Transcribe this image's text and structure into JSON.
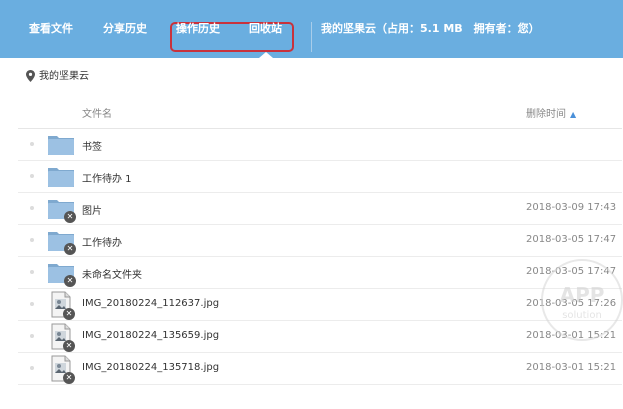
{
  "nav": {
    "view_files": "查看文件",
    "share_history": "分享历史",
    "operation_history": "操作历史",
    "recycle_bin": "回收站",
    "account_info": "我的坚果云（占用：5.1 MB　拥有者：您）"
  },
  "breadcrumb": {
    "label": "我的坚果云"
  },
  "table": {
    "col_name": "文件名",
    "col_time": "删除时间",
    "sort_indicator": "▲",
    "rows": [
      {
        "name": "书签",
        "time": "",
        "kind": "folder",
        "deleted": false
      },
      {
        "name": "工作待办 1",
        "time": "",
        "kind": "folder",
        "deleted": false
      },
      {
        "name": "图片",
        "time": "2018-03-09 17:43",
        "kind": "folder",
        "deleted": true
      },
      {
        "name": "工作待办",
        "time": "2018-03-05 17:47",
        "kind": "folder",
        "deleted": true
      },
      {
        "name": "未命名文件夹",
        "time": "2018-03-05 17:47",
        "kind": "folder",
        "deleted": true
      },
      {
        "name": "IMG_20180224_112637.jpg",
        "time": "2018-03-05 17:26",
        "kind": "image",
        "deleted": true
      },
      {
        "name": "IMG_20180224_135659.jpg",
        "time": "2018-03-01 15:21",
        "kind": "image",
        "deleted": true
      },
      {
        "name": "IMG_20180224_135718.jpg",
        "time": "2018-03-01 15:21",
        "kind": "image",
        "deleted": true
      }
    ]
  },
  "watermark": {
    "line1": "APP",
    "line2": "solution"
  },
  "colors": {
    "topbar": "#6aaee0",
    "highlight_border": "#c8323c",
    "folder": "#7fa9cf"
  },
  "icons": {
    "location": "map-pin-icon",
    "folder": "folder-icon",
    "image_file": "image-file-icon",
    "deleted": "deleted-badge-icon"
  }
}
